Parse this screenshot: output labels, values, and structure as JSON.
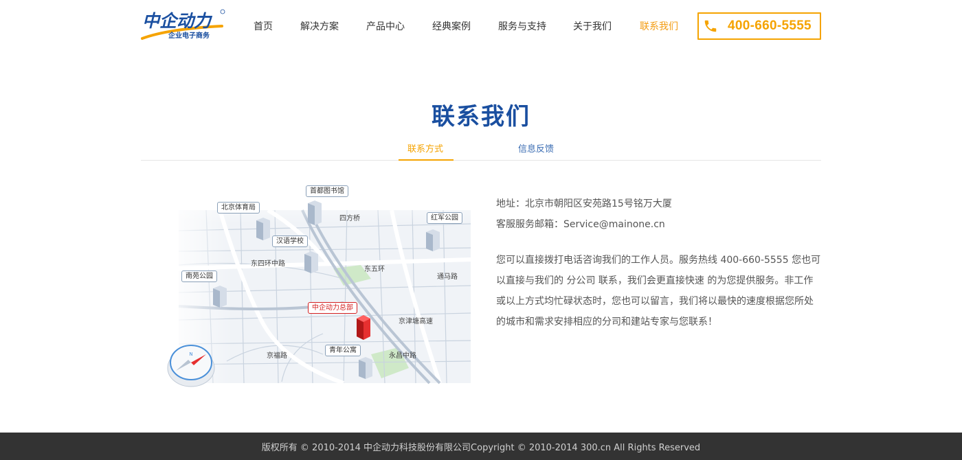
{
  "header": {
    "logo": {
      "brand_text": "中企动力",
      "tagline": "企业电子商务",
      "brand_color": "#1a4fa0",
      "swoosh_color": "#f5a300"
    },
    "nav": [
      {
        "label": "首页",
        "active": false
      },
      {
        "label": "解决方案",
        "active": false
      },
      {
        "label": "产品中心",
        "active": false
      },
      {
        "label": "经典案例",
        "active": false
      },
      {
        "label": "服务与支持",
        "active": false
      },
      {
        "label": "关于我们",
        "active": false
      },
      {
        "label": "联系我们",
        "active": true
      }
    ],
    "phone": {
      "icon": "phone-icon",
      "number": "400-660-5555"
    }
  },
  "page": {
    "title": "联系我们",
    "tabs": [
      {
        "label": "联系方式",
        "active": true
      },
      {
        "label": "信息反馈",
        "active": false
      }
    ]
  },
  "map": {
    "landmarks": [
      "首都图书馆",
      "北京体育局",
      "红军公园",
      "汉语学校",
      "南苑公园",
      "中企动力总部",
      "青年公寓"
    ],
    "roads": [
      "四方桥",
      "东四环中路",
      "东五环",
      "通马路",
      "京津塘高速",
      "京福路",
      "永昌中路"
    ],
    "compass": "compass-icon"
  },
  "contact": {
    "address": "地址：北京市朝阳区安苑路15号铭万大厦",
    "email": "客服服务邮箱：Service@mainone.cn",
    "description": "您可以直接拨打电话咨询我们的工作人员。服务热线 400-660-5555 您也可以直接与我们的 分公司 联系，我们会更直接快速 的为您提供服务。非工作或以上方式均忙碌状态时，您也可以留言，我们将以最快的速度根据您所处的城市和需求安排相应的分司和建站专家与您联系！"
  },
  "footer": {
    "text": "版权所有 © 2010-2014 中企动力科技股份有限公司Copyright © 2010-2014 300.cn All Rights Reserved"
  },
  "colors": {
    "accent": "#f5a300",
    "title_blue": "#1a4fa0",
    "footer_bg": "#333333"
  }
}
